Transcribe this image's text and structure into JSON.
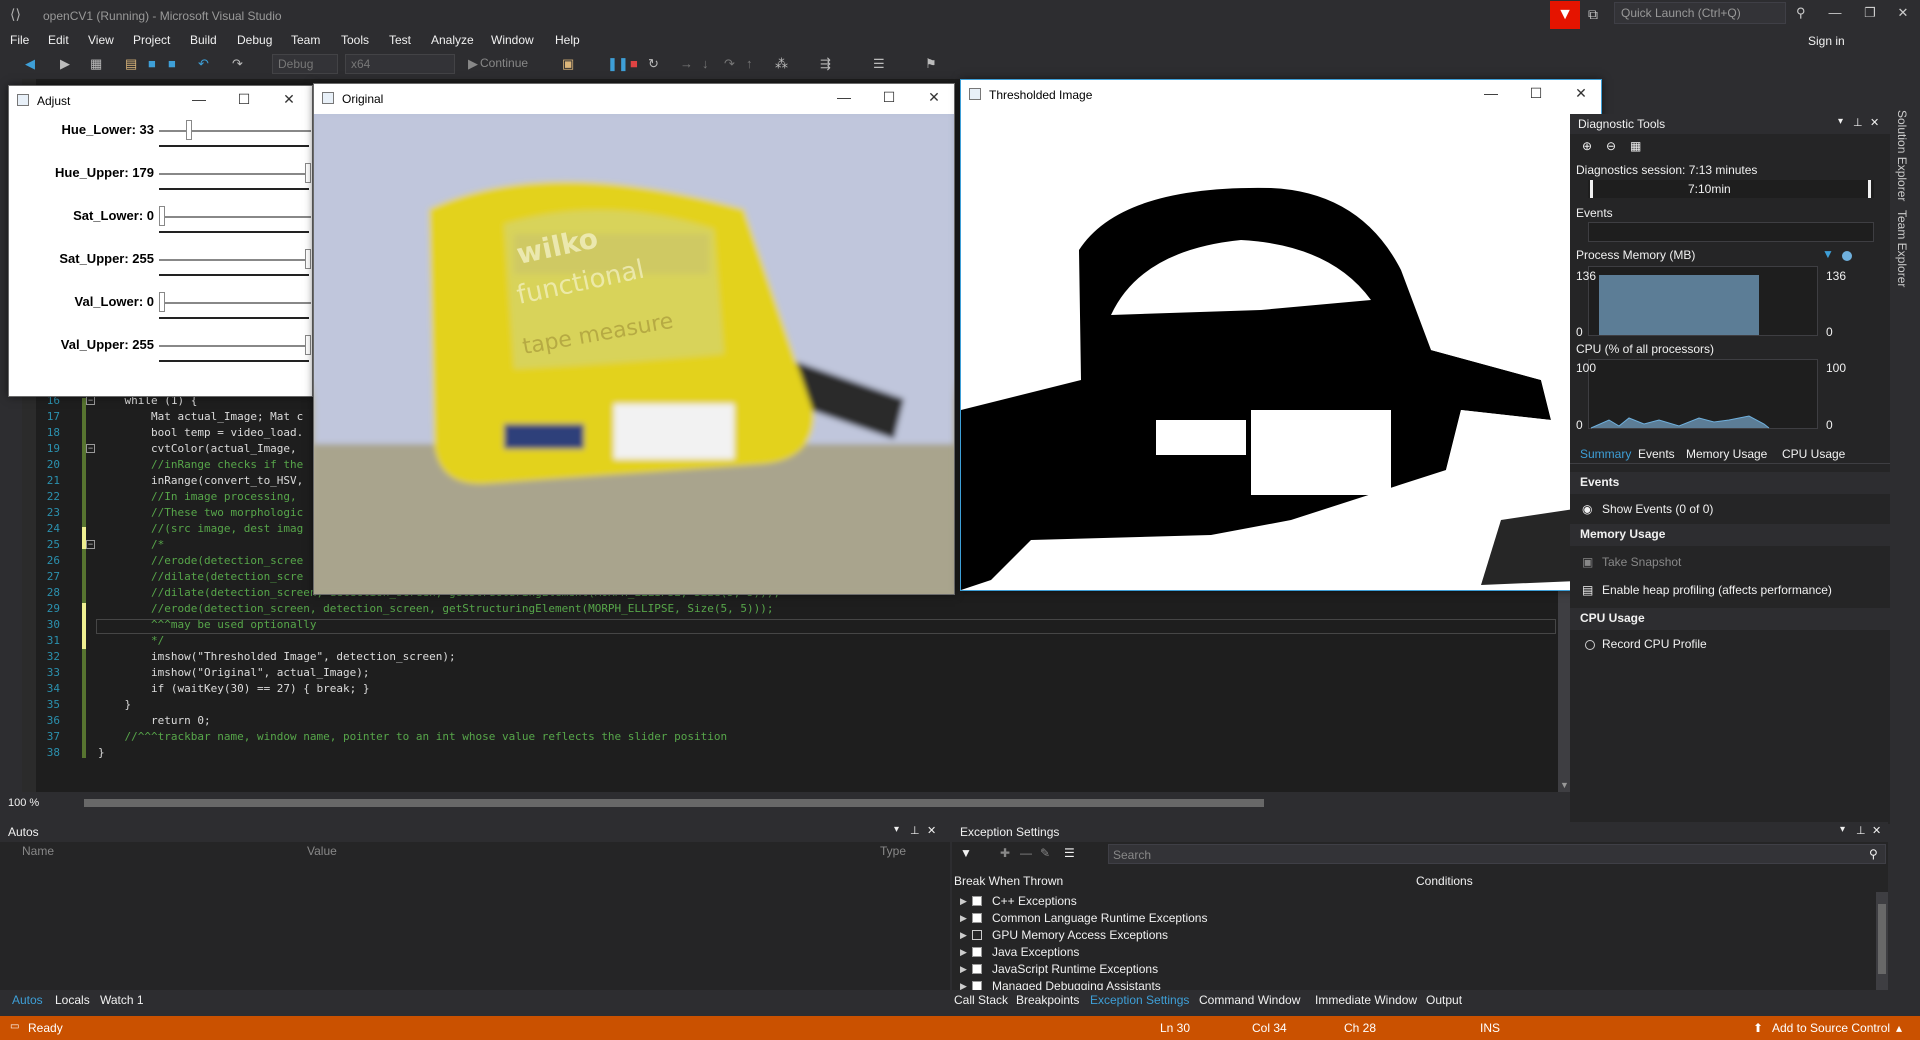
{
  "window": {
    "title": "openCV1 (Running) - Microsoft Visual Studio",
    "quick_launch_placeholder": "Quick Launch (Ctrl+Q)",
    "sign_in": "Sign in"
  },
  "menu": [
    "File",
    "Edit",
    "View",
    "Project",
    "Build",
    "Debug",
    "Team",
    "Tools",
    "Test",
    "Analyze",
    "Window",
    "Help"
  ],
  "toolbar": {
    "config": "Debug",
    "platform": "x64",
    "continue": "Continue"
  },
  "side_tabs": [
    "Solution Explorer",
    "Team Explorer"
  ],
  "editor": {
    "zoom": "100 %",
    "lines": [
      {
        "n": "16",
        "text": "    while (1) {"
      },
      {
        "n": "17",
        "text": "        Mat actual_Image; Mat c"
      },
      {
        "n": "18",
        "text": "        bool temp = video_load."
      },
      {
        "n": "19",
        "text": "        cvtColor(actual_Image,"
      },
      {
        "n": "20",
        "text": "        //inRange checks if the"
      },
      {
        "n": "21",
        "text": "        inRange(convert_to_HSV,"
      },
      {
        "n": "22",
        "text": "        //In image processing,"
      },
      {
        "n": "23",
        "text": "        //These two morphologic"
      },
      {
        "n": "24",
        "text": "        //(src image, dest imag"
      },
      {
        "n": "25",
        "text": "        /*"
      },
      {
        "n": "26",
        "text": "        //erode(detection_scree"
      },
      {
        "n": "27",
        "text": "        //dilate(detection_scre"
      },
      {
        "n": "28",
        "text": "        //dilate(detection_screen, detection_screen, getStructuringElement(MORPH_ELLIPSE, Size(5, 5)));"
      },
      {
        "n": "29",
        "text": "        //erode(detection_screen, detection_screen, getStructuringElement(MORPH_ELLIPSE, Size(5, 5)));"
      },
      {
        "n": "30",
        "text": "        ^^^may be used optionally"
      },
      {
        "n": "31",
        "text": "        */"
      },
      {
        "n": "32",
        "text": "        imshow(\"Thresholded Image\", detection_screen);"
      },
      {
        "n": "33",
        "text": "        imshow(\"Original\", actual_Image);"
      },
      {
        "n": "34",
        "text": "        if (waitKey(30) == 27) { break; }"
      },
      {
        "n": "35",
        "text": "    }"
      },
      {
        "n": "36",
        "text": "        return 0;"
      },
      {
        "n": "37",
        "text": "    //^^^trackbar name, window name, pointer to an int whose value reflects the slider position"
      },
      {
        "n": "38",
        "text": "}"
      }
    ]
  },
  "adjust_window": {
    "title": "Adjust",
    "trackbars": [
      {
        "label": "Hue_Lower: 33",
        "value": 33,
        "max": 179
      },
      {
        "label": "Hue_Upper: 179",
        "value": 179,
        "max": 179
      },
      {
        "label": "Sat_Lower: 0",
        "value": 0,
        "max": 255
      },
      {
        "label": "Sat_Upper: 255",
        "value": 255,
        "max": 255
      },
      {
        "label": "Val_Lower: 0",
        "value": 0,
        "max": 255
      },
      {
        "label": "Val_Upper: 255",
        "value": 255,
        "max": 255
      }
    ]
  },
  "original_window": {
    "title": "Original",
    "tape_text": [
      "wilko",
      "functional",
      "tape measure"
    ]
  },
  "threshold_window": {
    "title": "Thresholded Image"
  },
  "diagnostic": {
    "title": "Diagnostic Tools",
    "session": "Diagnostics session: 7:13 minutes",
    "time_mark": "7:10min",
    "events_label": "Events",
    "memory_label": "Process Memory (MB)",
    "memory_max": "136",
    "memory_min": "0",
    "memory_left_max": "136",
    "memory_left_min": "0",
    "cpu_label": "CPU (% of all processors)",
    "cpu_max": "100",
    "cpu_min": "0",
    "cpu_left_max": "100",
    "cpu_left_min": "0",
    "tabs": [
      "Summary",
      "Events",
      "Memory Usage",
      "CPU Usage"
    ],
    "events_section": "Events",
    "show_events": "Show Events (0 of 0)",
    "memory_section": "Memory Usage",
    "take_snapshot": "Take Snapshot",
    "heap_profiling": "Enable heap profiling (affects performance)",
    "cpu_section": "CPU Usage",
    "record_cpu": "Record CPU Profile"
  },
  "autos": {
    "title": "Autos",
    "columns": [
      "Name",
      "Value",
      "Type"
    ],
    "tabs": [
      "Autos",
      "Locals",
      "Watch 1"
    ]
  },
  "exceptions": {
    "title": "Exception Settings",
    "search_placeholder": "Search",
    "columns": [
      "Break When Thrown",
      "Conditions"
    ],
    "items": [
      {
        "label": "C++ Exceptions",
        "checked": true
      },
      {
        "label": "Common Language Runtime Exceptions",
        "checked": true
      },
      {
        "label": "GPU Memory Access Exceptions",
        "checked": false
      },
      {
        "label": "Java Exceptions",
        "checked": true
      },
      {
        "label": "JavaScript Runtime Exceptions",
        "checked": true
      },
      {
        "label": "Managed Debugging Assistants",
        "checked": true
      }
    ],
    "tabs": [
      "Call Stack",
      "Breakpoints",
      "Exception Settings",
      "Command Window",
      "Immediate Window",
      "Output"
    ]
  },
  "status": {
    "ready": "Ready",
    "ln": "Ln 30",
    "col": "Col 34",
    "ch": "Ch 28",
    "ins": "INS",
    "source_control": "Add to Source Control"
  }
}
